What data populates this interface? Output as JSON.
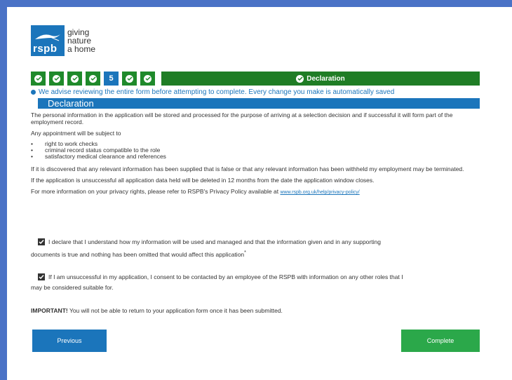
{
  "logo": {
    "text": "rspb",
    "tagline_1": "giving",
    "tagline_2": "nature",
    "tagline_3": "a home"
  },
  "steps": {
    "current_step_number": "5",
    "current_title": "Declaration"
  },
  "advice": "We advise reviewing the entire form before attempting to complete. Every change you make is automatically saved",
  "section_title": "Declaration",
  "content": {
    "p1": "The personal information in the application will be stored and processed for the purpose of arriving at a selection decision and if successful it will form part of the employment record.",
    "p2": "Any appointment will be subject to",
    "list": [
      "right to work checks",
      "criminal record status compatible to the role",
      "satisfactory medical clearance and references"
    ],
    "p3": "If it is discovered that any relevant information has been supplied that is false or that any relevant information has been withheld  my employment may be terminated.",
    "p4": "If the application is unsuccessful all application data held will be deleted in 12 months from the date the application window closes.",
    "p5": "For more information on your privacy rights, please refer to RSPB's Privacy Policy available at",
    "privacy_link": "www.rspb.org.uk/help/privacy-policy/"
  },
  "declarations": {
    "d1_line1": "I declare that I understand how my information will be used and managed and that the information given and in any supporting",
    "d1_line2": "documents is true and nothing has been omitted that would affect this application",
    "d1_required": "*",
    "d2_line1": "If I am unsuccessful in my application, I consent to be contacted by an employee of the RSPB with information on any other roles that I",
    "d2_line2": "may be considered suitable for."
  },
  "important": {
    "label": "IMPORTANT!",
    "text": " You will not be able to return to your application form once it has been submitted."
  },
  "buttons": {
    "previous": "Previous",
    "complete": "Complete"
  },
  "colors": {
    "primary_blue": "#1b75bb",
    "step_green": "#1f8a2b",
    "complete_green": "#2ba84a",
    "frame_blue": "#4a72c6"
  }
}
